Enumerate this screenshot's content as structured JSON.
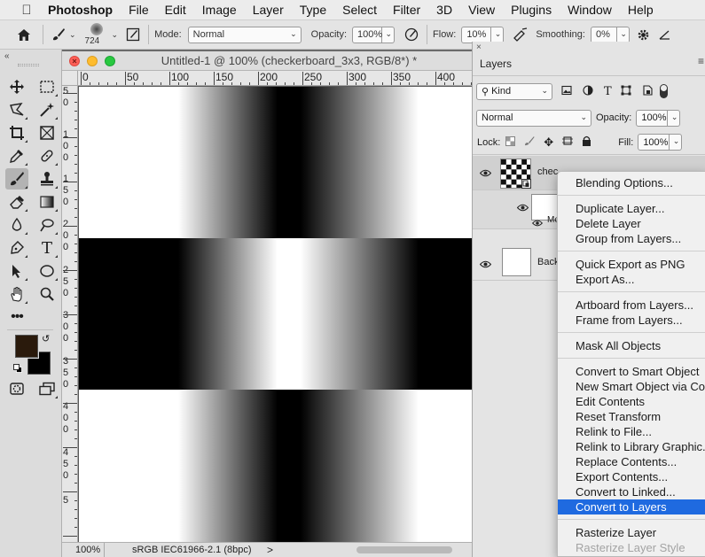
{
  "menubar": {
    "app": "Photoshop",
    "items": [
      "File",
      "Edit",
      "Image",
      "Layer",
      "Type",
      "Select",
      "Filter",
      "3D",
      "View",
      "Plugins",
      "Window",
      "Help"
    ]
  },
  "options": {
    "brush_size": "724",
    "mode_label": "Mode:",
    "mode_value": "Normal",
    "opacity_label": "Opacity:",
    "opacity_value": "100%",
    "flow_label": "Flow:",
    "flow_value": "10%",
    "smoothing_label": "Smoothing:",
    "smoothing_value": "0%"
  },
  "document": {
    "title": "Untitled-1 @ 100% (checkerboard_3x3, RGB/8*) *",
    "ruler_h": [
      "0",
      "50",
      "100",
      "150",
      "200",
      "250",
      "300",
      "350",
      "400"
    ],
    "ruler_v": [
      {
        "d": "5"
      },
      {
        "d": "0"
      },
      {
        "d": "1"
      },
      {
        "d": "0"
      },
      {
        "d": "0"
      },
      {
        "d": "1"
      },
      {
        "d": "5"
      },
      {
        "d": "0"
      },
      {
        "d": "2"
      },
      {
        "d": "0"
      },
      {
        "d": "0"
      },
      {
        "d": "2"
      },
      {
        "d": "5"
      },
      {
        "d": "0"
      },
      {
        "d": "3"
      },
      {
        "d": "0"
      },
      {
        "d": "0"
      },
      {
        "d": "3"
      },
      {
        "d": "5"
      },
      {
        "d": "0"
      },
      {
        "d": "4"
      },
      {
        "d": "0"
      },
      {
        "d": "0"
      },
      {
        "d": "4"
      },
      {
        "d": "5"
      },
      {
        "d": "0"
      },
      {
        "d": "5"
      }
    ],
    "zoom": "100%",
    "color_profile": "sRGB IEC61966-2.1 (8bpc)",
    "status_arrow": ">"
  },
  "layers_panel": {
    "tab": "Layers",
    "filter_kind": "Kind",
    "blend_mode": "Normal",
    "opacity_label": "Opacity:",
    "opacity_value": "100%",
    "lock_label": "Lock:",
    "fill_label": "Fill:",
    "fill_value": "100%",
    "layer1_name": "chec",
    "layer1_sub": "Mo",
    "layer2_name": "Back"
  },
  "context_menu": {
    "groups": [
      [
        "Blending Options..."
      ],
      [
        "Duplicate Layer...",
        "Delete Layer",
        "Group from Layers..."
      ],
      [
        "Quick Export as PNG",
        "Export As..."
      ],
      [
        "Artboard from Layers...",
        "Frame from Layers..."
      ],
      [
        "Mask All Objects"
      ],
      [
        "Convert to Smart Object",
        "New Smart Object via Cop",
        "Edit Contents",
        "Reset Transform",
        "Relink to File...",
        "Relink to Library Graphic...",
        "Replace Contents...",
        "Export Contents...",
        "Convert to Linked...",
        "Convert to Layers"
      ],
      [
        "Rasterize Layer",
        "Rasterize Layer Style"
      ]
    ],
    "highlighted": "Convert to Layers",
    "disabled": [
      "Rasterize Layer Style"
    ]
  },
  "colors": {
    "foreground": "#2a1a0c",
    "background": "#000000",
    "highlight": "#1f6ae0"
  }
}
